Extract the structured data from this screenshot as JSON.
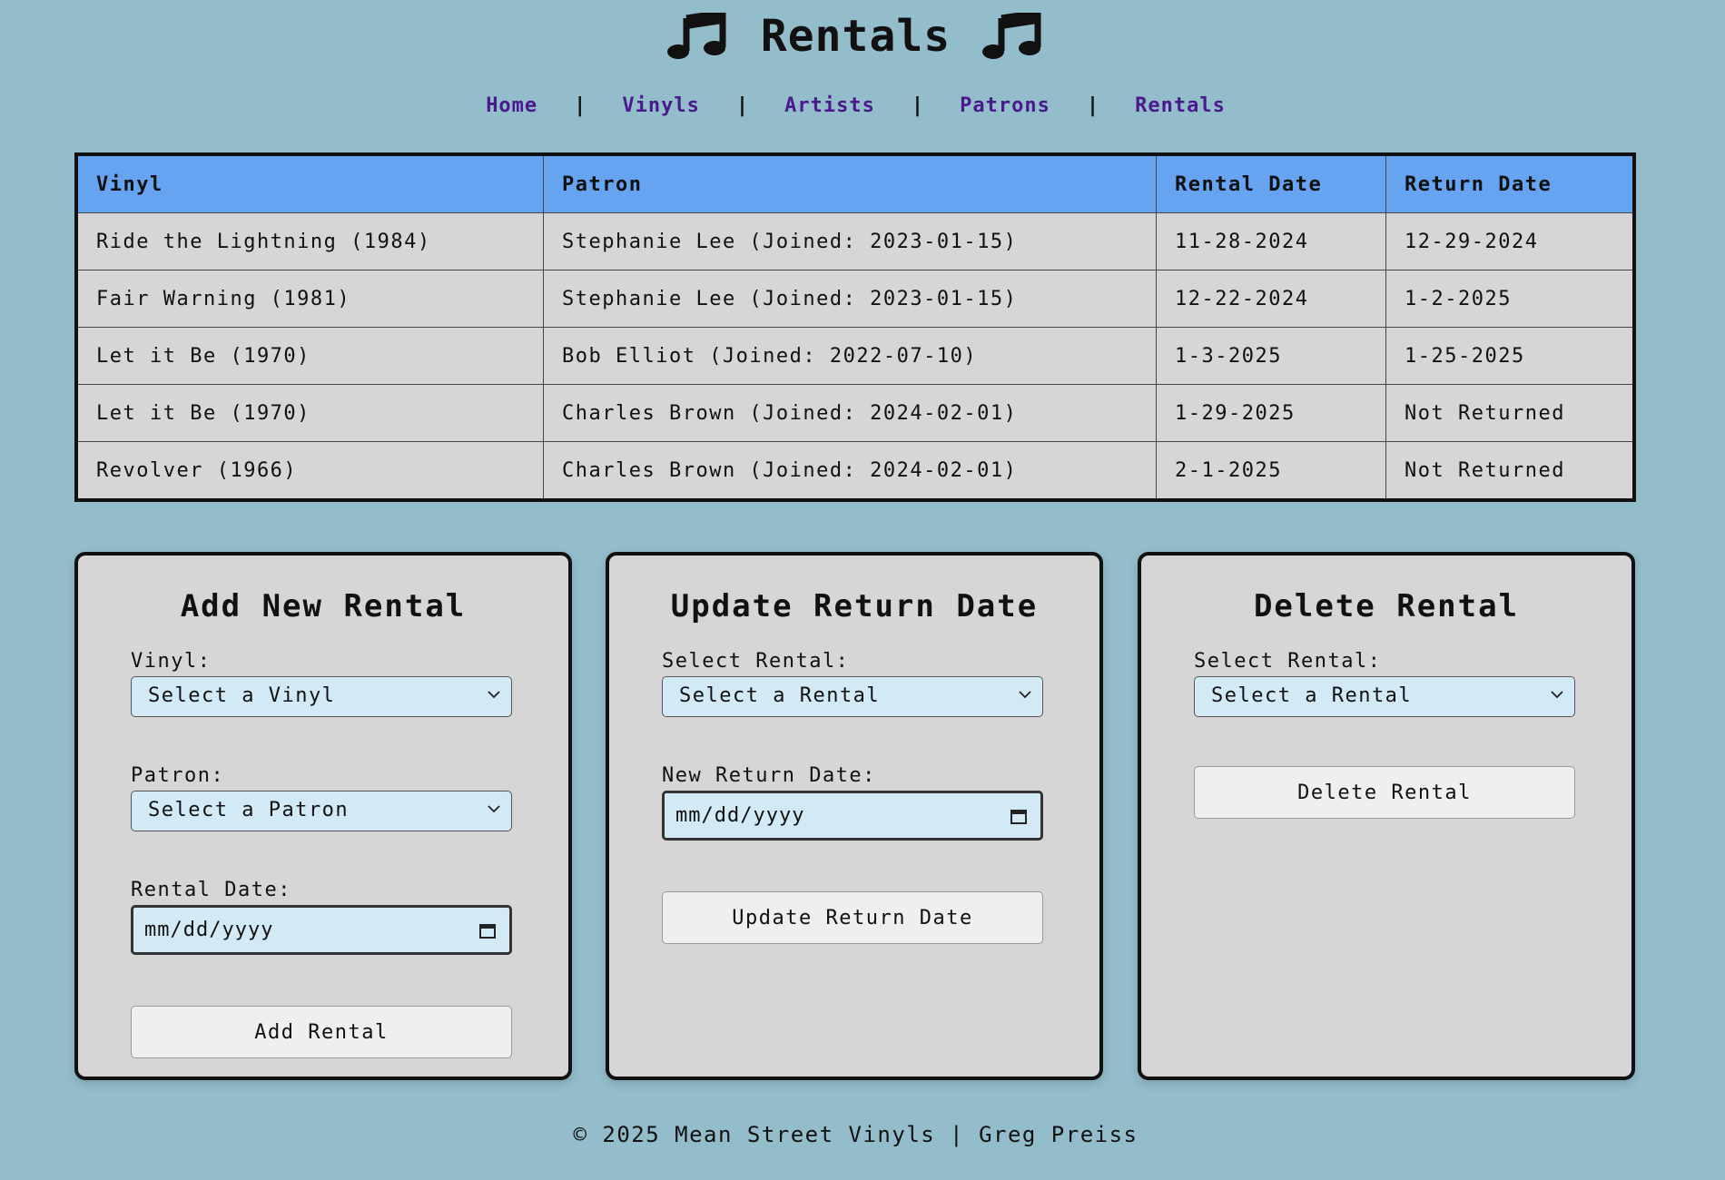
{
  "header": {
    "title": "Rentals",
    "left_icon": "music-note-icon",
    "right_icon": "music-note-icon"
  },
  "nav": {
    "items": [
      "Home",
      "Vinyls",
      "Artists",
      "Patrons",
      "Rentals"
    ],
    "separator": "|"
  },
  "table": {
    "headers": [
      "Vinyl",
      "Patron",
      "Rental Date",
      "Return Date"
    ],
    "rows": [
      [
        "Ride the Lightning (1984)",
        "Stephanie Lee (Joined: 2023-01-15)",
        "11-28-2024",
        "12-29-2024"
      ],
      [
        "Fair Warning (1981)",
        "Stephanie Lee (Joined: 2023-01-15)",
        "12-22-2024",
        "1-2-2025"
      ],
      [
        "Let it Be (1970)",
        "Bob Elliot (Joined: 2022-07-10)",
        "1-3-2025",
        "1-25-2025"
      ],
      [
        "Let it Be (1970)",
        "Charles Brown (Joined: 2024-02-01)",
        "1-29-2025",
        "Not Returned"
      ],
      [
        "Revolver (1966)",
        "Charles Brown (Joined: 2024-02-01)",
        "2-1-2025",
        "Not Returned"
      ]
    ]
  },
  "add_form": {
    "title": "Add New Rental",
    "vinyl_label": "Vinyl:",
    "vinyl_value": "Select a Vinyl",
    "patron_label": "Patron:",
    "patron_value": "Select a Patron",
    "date_label": "Rental Date:",
    "date_placeholder": "mm/dd/yyyy",
    "button": "Add Rental"
  },
  "update_form": {
    "title": "Update Return Date",
    "rental_label": "Select Rental:",
    "rental_value": "Select a Rental",
    "date_label": "New Return Date:",
    "date_placeholder": "mm/dd/yyyy",
    "button": "Update Return Date"
  },
  "delete_form": {
    "title": "Delete Rental",
    "rental_label": "Select Rental:",
    "rental_value": "Select a Rental",
    "button": "Delete Rental"
  },
  "footer": {
    "text": "© 2025 Mean Street Vinyls | Greg Preiss"
  },
  "colors": {
    "background": "#93bdcb",
    "table_header": "#66a3f1",
    "cell": "#d6d6d6",
    "input": "#d2eaf6",
    "nav_link": "#4a1a8c"
  }
}
